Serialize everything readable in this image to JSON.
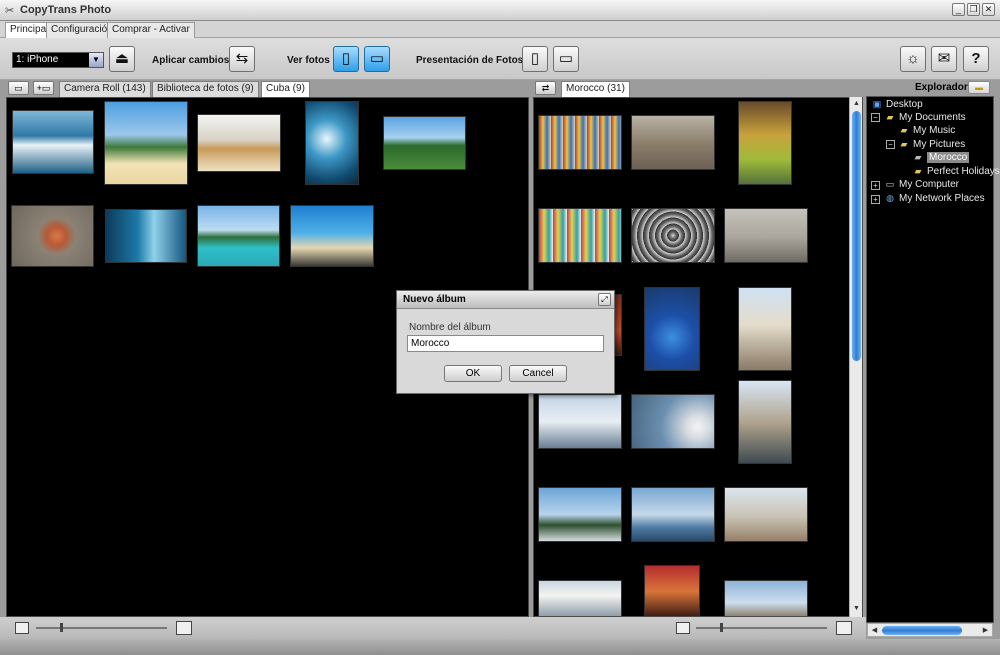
{
  "window": {
    "title": "CopyTrans Photo"
  },
  "menu_tabs": [
    "Principal",
    "Configuración",
    "Comprar - Activar"
  ],
  "toolbar": {
    "device": "1: iPhone",
    "apply_label": "Aplicar cambios",
    "view_label": "Ver fotos",
    "slideshow_label": "Presentación de Fotos"
  },
  "left_tabs": [
    "Camera Roll (143)",
    "Biblioteca de fotos (9)",
    "Cuba (9)"
  ],
  "right_tabs": [
    "Morocco (31)"
  ],
  "explorer": {
    "label": "Explorador",
    "tree": [
      "Desktop",
      "My Documents",
      "My Music",
      "My Pictures",
      "Morocco",
      "Perfect Holidays",
      "My Computer",
      "My Network Places"
    ]
  },
  "dialog": {
    "title": "Nuevo álbum",
    "field_label": "Nombre del álbum",
    "field_value": "Morocco",
    "ok": "OK",
    "cancel": "Cancel"
  },
  "colors": {
    "panel_bg": "#000000",
    "accent_blue": "#2e9ee8",
    "chrome": "#d4d4d4"
  },
  "icons": {
    "eject": "eject-icon",
    "apply": "swap-arrows-icon",
    "ipod": "ipod-icon",
    "monitor": "monitor-icon",
    "tips": "lightbulb-icon",
    "mail": "mail-icon",
    "help": "help-icon"
  }
}
